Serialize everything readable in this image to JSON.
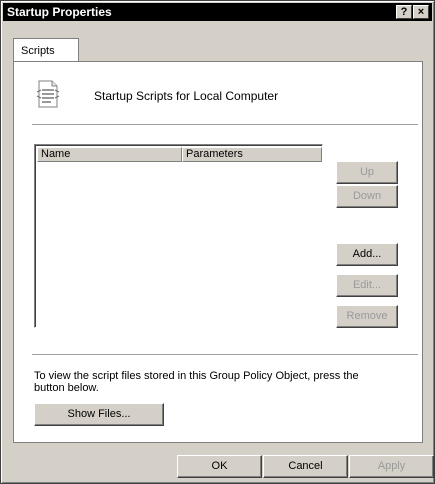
{
  "window": {
    "title": "Startup Properties",
    "help_glyph": "?",
    "close_glyph": "×"
  },
  "tabs": [
    {
      "label": "Scripts",
      "selected": true
    }
  ],
  "scripts": {
    "heading": "Startup Scripts for Local Computer",
    "icon": "script-file-icon",
    "columns": [
      "Name",
      "Parameters"
    ],
    "rows": [],
    "buttons": {
      "up": {
        "label": "Up",
        "enabled": false
      },
      "down": {
        "label": "Down",
        "enabled": false
      },
      "add": {
        "label": "Add...",
        "enabled": true
      },
      "edit": {
        "label": "Edit...",
        "enabled": false
      },
      "remove": {
        "label": "Remove",
        "enabled": false
      }
    },
    "info_text": "To view the script files stored in this Group Policy Object, press the button below.",
    "show_files_label": "Show Files..."
  },
  "footer": {
    "ok_label": "OK",
    "cancel_label": "Cancel",
    "apply_label": "Apply",
    "apply_enabled": false
  }
}
